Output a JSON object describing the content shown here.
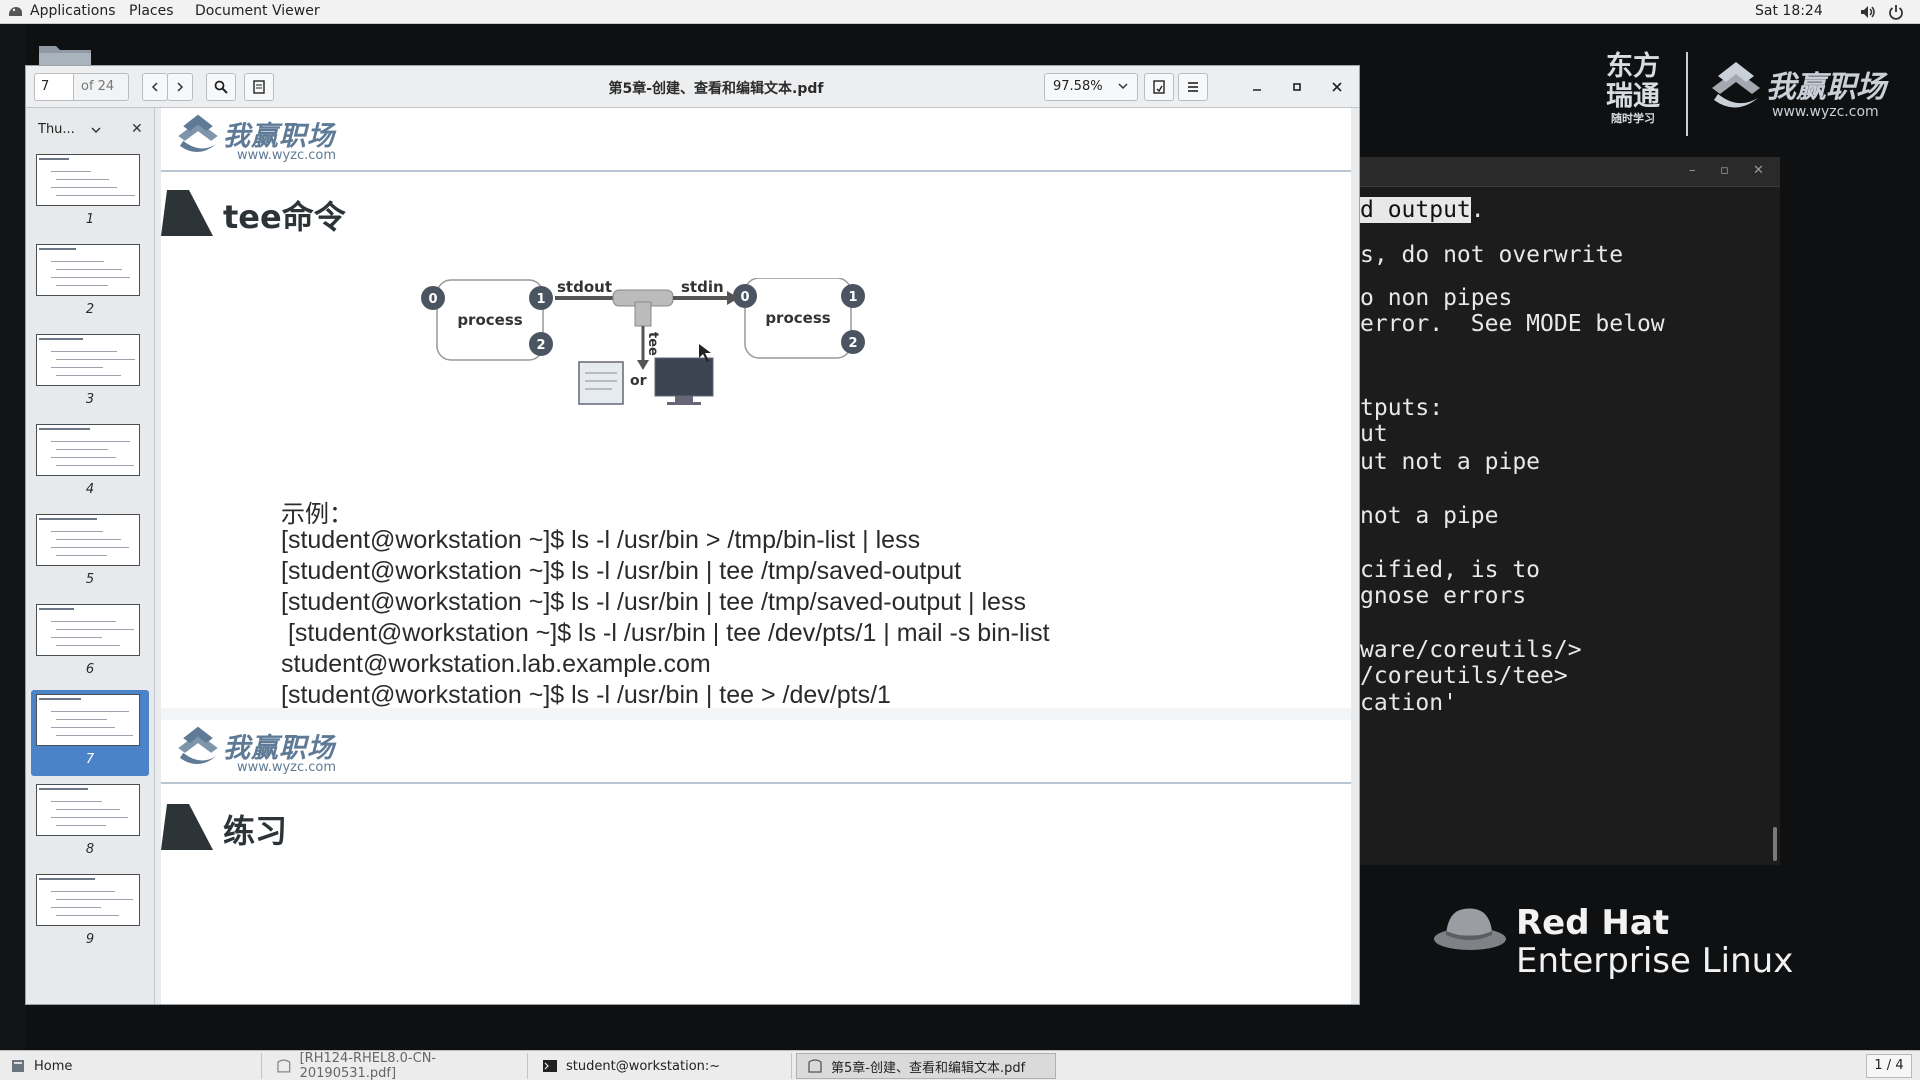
{
  "topbar": {
    "applications": "Applications",
    "places": "Places",
    "document_viewer": "Document Viewer",
    "clock": "Sat 18:24"
  },
  "terminal": {
    "lines": [
      "d output.",
      "s, do not overwrite",
      "o non pipes",
      "error.  See MODE below",
      "tputs:",
      "ut",
      "ut not a pipe",
      "not a pipe",
      "cified, is to",
      "gnose errors",
      "ware/coreutils/>",
      "/coreutils/tee>",
      "cation'"
    ],
    "highlight": "d output"
  },
  "branding": {
    "dfrt": "东方\n瑞通",
    "dfrt_sub": "随时学习",
    "wyzc_text": "我赢职场",
    "wyzc_url": "www.wyzc.com",
    "redhat_line1": "Red Hat",
    "redhat_line2": "Enterprise Linux"
  },
  "viewer": {
    "page_current": "7",
    "page_total": "of 24",
    "title": "第5章-创建、查看和编辑文本.pdf",
    "zoom": "97.58%",
    "sidebar_mode": "Thu...",
    "thumbnails": [
      "1",
      "2",
      "3",
      "4",
      "5",
      "6",
      "7",
      "8",
      "9"
    ],
    "selected_thumb": "7"
  },
  "slide7": {
    "section_title": "tee命令",
    "diagram": {
      "process_left": "process",
      "process_right": "process",
      "stdout": "stdout",
      "stdin": "stdin",
      "tee": "tee",
      "or": "or",
      "fd0": "0",
      "fd1": "1",
      "fd2": "2"
    },
    "example_label": "示例：",
    "examples": [
      "[student@workstation ~]$ ls -l /usr/bin > /tmp/bin-list | less",
      "[student@workstation ~]$ ls -l /usr/bin | tee /tmp/saved-output",
      "[student@workstation ~]$ ls -l /usr/bin | tee /tmp/saved-output | less",
      " [student@workstation ~]$ ls -l /usr/bin | tee /dev/pts/1 | mail -s bin-list",
      "student@workstation.lab.example.com",
      "[student@workstation ~]$ ls -l /usr/bin | tee > /dev/pts/1"
    ]
  },
  "slide8": {
    "section_title": "练习"
  },
  "taskbar": {
    "home": "Home",
    "task_pdf": "[RH124-RHEL8.0-CN-20190531.pdf]",
    "task_terminal": "student@workstation:~",
    "task_viewer": "第5章-创建、查看和编辑文本.pdf",
    "workspace": "1 / 4"
  },
  "colors": {
    "accent_selected": "#4a83c8",
    "slide_heading": "#2d3438",
    "logo_blue": "#5f7a96",
    "desktop_bg": "#0e1012"
  }
}
